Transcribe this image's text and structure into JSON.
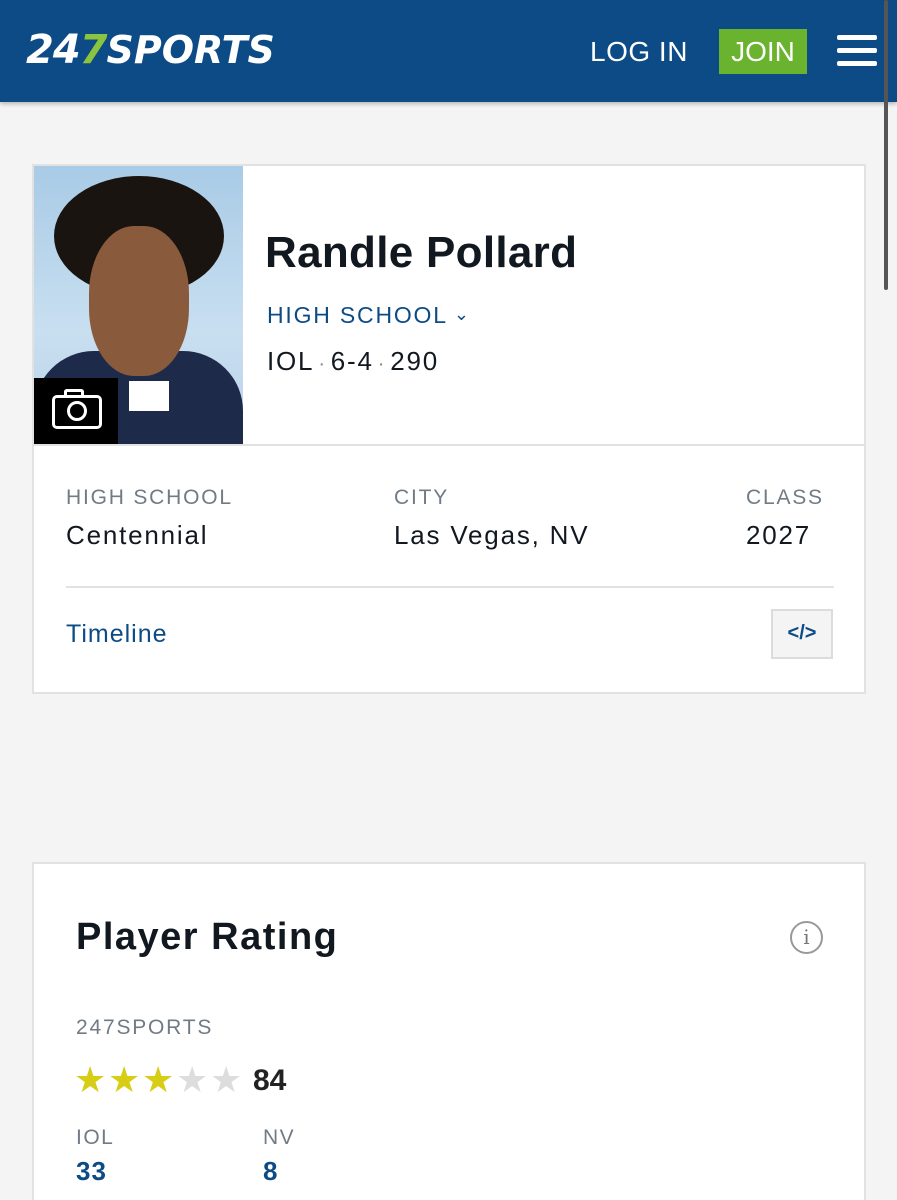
{
  "header": {
    "logo_number": "24",
    "logo_seven": "7",
    "logo_word": "SPORTS",
    "login_label": "LOG IN",
    "join_label": "JOIN"
  },
  "player": {
    "name": "Randle Pollard",
    "level_label": "HIGH SCHOOL",
    "position": "IOL",
    "height": "6-4",
    "weight": "290",
    "separator": "·"
  },
  "details": {
    "high_school_label": "HIGH SCHOOL",
    "high_school_value": "Centennial",
    "city_label": "CITY",
    "city_value": "Las Vegas, NV",
    "class_label": "CLASS",
    "class_value": "2027",
    "timeline_label": "Timeline",
    "embed_label": "</>"
  },
  "rating": {
    "title": "Player Rating",
    "info_icon": "i",
    "source_label": "247SPORTS",
    "stars_filled": 3,
    "stars_total": 5,
    "score": "84",
    "position_rank_label": "IOL",
    "position_rank_value": "33",
    "state_rank_label": "NV",
    "state_rank_value": "8"
  },
  "colors": {
    "brand_blue": "#0d4b86",
    "brand_green": "#8bc53f",
    "join_green": "#69b32f",
    "star_gold": "#d6cd14"
  }
}
